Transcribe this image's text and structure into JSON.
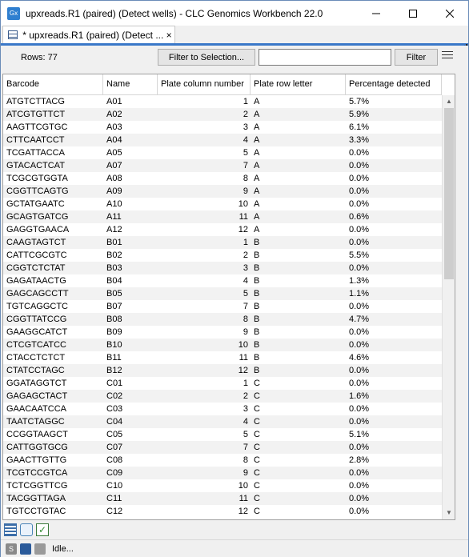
{
  "window": {
    "app_icon_text": "Gx",
    "title": "upxreads.R1 (paired) (Detect wells) - CLC Genomics Workbench 22.0"
  },
  "tab": {
    "label": "* upxreads.R1 (paired) (Detect ...",
    "close": "×"
  },
  "toolbar": {
    "rows_label": "Rows: 77",
    "filter_to_selection": "Filter to Selection...",
    "filter_value": "",
    "filter_button": "Filter"
  },
  "table": {
    "columns": [
      "Barcode",
      "Name",
      "Plate column number",
      "Plate row letter",
      "Percentage detected"
    ],
    "rows": [
      [
        "ATGTCTTACG",
        "A01",
        "1",
        "A",
        "5.7%"
      ],
      [
        "ATCGTGTTCT",
        "A02",
        "2",
        "A",
        "5.9%"
      ],
      [
        "AAGTTCGTGC",
        "A03",
        "3",
        "A",
        "6.1%"
      ],
      [
        "CTTCAATCCT",
        "A04",
        "4",
        "A",
        "3.3%"
      ],
      [
        "TCGATTACCA",
        "A05",
        "5",
        "A",
        "0.0%"
      ],
      [
        "GTACACTCAT",
        "A07",
        "7",
        "A",
        "0.0%"
      ],
      [
        "TCGCGTGGTA",
        "A08",
        "8",
        "A",
        "0.0%"
      ],
      [
        "CGGTTCAGTG",
        "A09",
        "9",
        "A",
        "0.0%"
      ],
      [
        "GCTATGAATC",
        "A10",
        "10",
        "A",
        "0.0%"
      ],
      [
        "GCAGTGATCG",
        "A11",
        "11",
        "A",
        "0.6%"
      ],
      [
        "GAGGTGAACA",
        "A12",
        "12",
        "A",
        "0.0%"
      ],
      [
        "CAAGTAGTCT",
        "B01",
        "1",
        "B",
        "0.0%"
      ],
      [
        "CATTCGCGTC",
        "B02",
        "2",
        "B",
        "5.5%"
      ],
      [
        "CGGTCTCTAT",
        "B03",
        "3",
        "B",
        "0.0%"
      ],
      [
        "GAGATAACTG",
        "B04",
        "4",
        "B",
        "1.3%"
      ],
      [
        "GAGCAGCCTT",
        "B05",
        "5",
        "B",
        "1.1%"
      ],
      [
        "TGTCAGGCTC",
        "B07",
        "7",
        "B",
        "0.0%"
      ],
      [
        "CGGTTATCCG",
        "B08",
        "8",
        "B",
        "4.7%"
      ],
      [
        "GAAGGCATCT",
        "B09",
        "9",
        "B",
        "0.0%"
      ],
      [
        "CTCGTCATCC",
        "B10",
        "10",
        "B",
        "0.0%"
      ],
      [
        "CTACCTCTCT",
        "B11",
        "11",
        "B",
        "4.6%"
      ],
      [
        "CTATCCTAGC",
        "B12",
        "12",
        "B",
        "0.0%"
      ],
      [
        "GGATAGGTCT",
        "C01",
        "1",
        "C",
        "0.0%"
      ],
      [
        "GAGAGCTACT",
        "C02",
        "2",
        "C",
        "1.6%"
      ],
      [
        "GAACAATCCA",
        "C03",
        "3",
        "C",
        "0.0%"
      ],
      [
        "TAATCTAGGC",
        "C04",
        "4",
        "C",
        "0.0%"
      ],
      [
        "CCGGTAAGCT",
        "C05",
        "5",
        "C",
        "5.1%"
      ],
      [
        "CATTGGTGCG",
        "C07",
        "7",
        "C",
        "0.0%"
      ],
      [
        "GAACTTGTTG",
        "C08",
        "8",
        "C",
        "2.8%"
      ],
      [
        "TCGTCCGTCA",
        "C09",
        "9",
        "C",
        "0.0%"
      ],
      [
        "TCTCGGTTCG",
        "C10",
        "10",
        "C",
        "0.0%"
      ],
      [
        "TACGGTTAGA",
        "C11",
        "11",
        "C",
        "0.0%"
      ],
      [
        "TGTCCTGTAC",
        "C12",
        "12",
        "C",
        "0.0%"
      ]
    ]
  },
  "status": {
    "text": "Idle..."
  },
  "colors": {
    "accent": "#3a78c8",
    "window_border": "#6a8cb8"
  }
}
